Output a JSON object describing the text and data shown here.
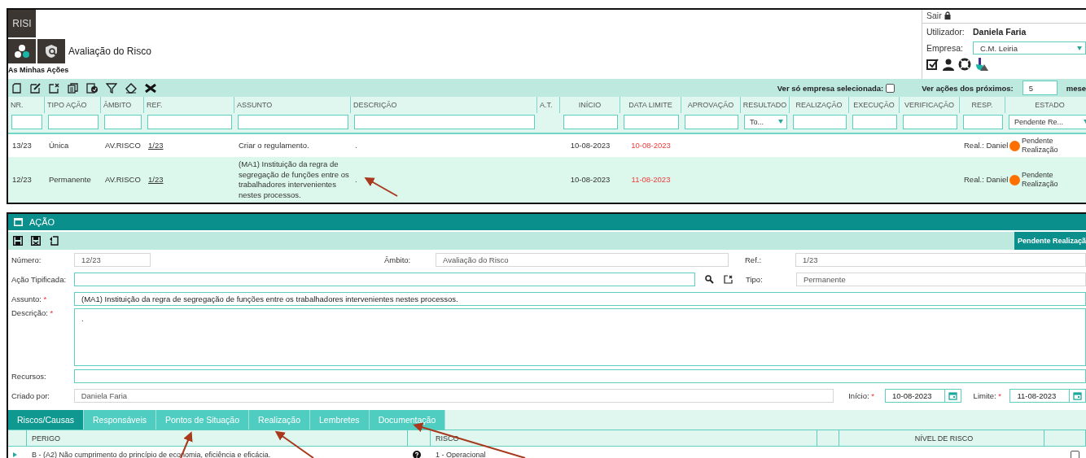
{
  "app": {
    "logo": "RISI",
    "module_title": "Avaliação do Risco",
    "section_title": "As Minhas Ações"
  },
  "session": {
    "logout": "Sair",
    "user_label": "Utilizador:",
    "user_name": "Daniela Faria",
    "company_label": "Empresa:",
    "company": "C.M. Leiria"
  },
  "list_options": {
    "company_only_label": "Ver só empresa selecionada:",
    "company_only_checked": false,
    "months_label": "Ver ações dos próximos:",
    "months_value": "5",
    "months_unit": "mese"
  },
  "table": {
    "columns": [
      "NR.",
      "TIPO AÇÃO",
      "ÂMBITO",
      "REF.",
      "ASSUNTO",
      "DESCRIÇÃO",
      "A.T.",
      "INÍCIO",
      "DATA LIMITE",
      "APROVAÇÃO",
      "RESULTADO",
      "REALIZAÇÃO",
      "EXECUÇÃO",
      "VERIFICAÇÃO",
      "RESP.",
      "ESTADO"
    ],
    "filters": [
      {
        "kind": "text"
      },
      {
        "kind": "text"
      },
      {
        "kind": "text"
      },
      {
        "kind": "text"
      },
      {
        "kind": "text"
      },
      {
        "kind": "text"
      },
      {
        "kind": "none"
      },
      {
        "kind": "text"
      },
      {
        "kind": "text"
      },
      {
        "kind": "text"
      },
      {
        "kind": "select",
        "value": "To..."
      },
      {
        "kind": "text"
      },
      {
        "kind": "text"
      },
      {
        "kind": "text"
      },
      {
        "kind": "text"
      },
      {
        "kind": "select",
        "value": "Pendente Re..."
      }
    ],
    "rows": [
      {
        "nr": "13/23",
        "type": "Única",
        "scope": "AV.RISCO",
        "ref": "1/23",
        "subject": "Criar o regulamento.",
        "description": ".",
        "start": "10-08-2023",
        "deadline": "10-08-2023",
        "overdue": true,
        "resp": "Real.: Daniel",
        "status": "Pendente Realização",
        "color": "#ff6f00",
        "selected": false
      },
      {
        "nr": "12/23",
        "type": "Permanente",
        "scope": "AV.RISCO",
        "ref": "1/23",
        "subject": "(MA1) Instituição da regra de segregação de funções entre os trabalhadores intervenientes nestes processos.",
        "description": ".",
        "start": "10-08-2023",
        "deadline": "11-08-2023",
        "overdue": true,
        "resp": "Real.: Daniel",
        "status": "Pendente Realização",
        "color": "#ff6f00",
        "selected": true
      }
    ]
  },
  "form": {
    "title": "AÇÃO",
    "status": "Pendente Realizaçã",
    "number": {
      "label": "Número:",
      "value": "12/23"
    },
    "scope": {
      "label": "Âmbito:",
      "value": "Avaliação do Risco"
    },
    "ref": {
      "label": "Ref.:",
      "value": "1/23"
    },
    "typified": {
      "label": "Ação Tipificada:"
    },
    "type": {
      "label": "Tipo:",
      "value": "Permanente"
    },
    "subject": {
      "label": "Assunto:",
      "required_mark": "*",
      "value": "(MA1) Instituição da regra de segregação de funções entre os trabalhadores intervenientes nestes processos."
    },
    "description": {
      "label": "Descrição:",
      "required_mark": "*",
      "value": "."
    },
    "resources": {
      "label": "Recursos:"
    },
    "created_by": {
      "label": "Criado por:",
      "value": "Daniela Faria"
    },
    "start": {
      "label": "Início:",
      "required_mark": "*",
      "value": "10-08-2023"
    },
    "deadline": {
      "label": "Limite:",
      "required_mark": "*",
      "value": "11-08-2023"
    }
  },
  "tabs": [
    {
      "label": "Riscos/Causas",
      "selected": true
    },
    {
      "label": "Responsáveis",
      "selected": false
    },
    {
      "label": "Pontos de Situação",
      "selected": false
    },
    {
      "label": "Realização",
      "selected": false
    },
    {
      "label": "Lembretes",
      "selected": false
    },
    {
      "label": "Documentação",
      "selected": false
    }
  ],
  "risk_grid": {
    "columns": [
      "PERIGO",
      "RISCO",
      "NÍVEL DE RISCO"
    ],
    "rows": [
      {
        "hazard": "B - (A2) Não cumprimento do princípio de economia, eficiência e eficácia.",
        "risk": "1 - Operacional",
        "checked": false
      }
    ]
  }
}
